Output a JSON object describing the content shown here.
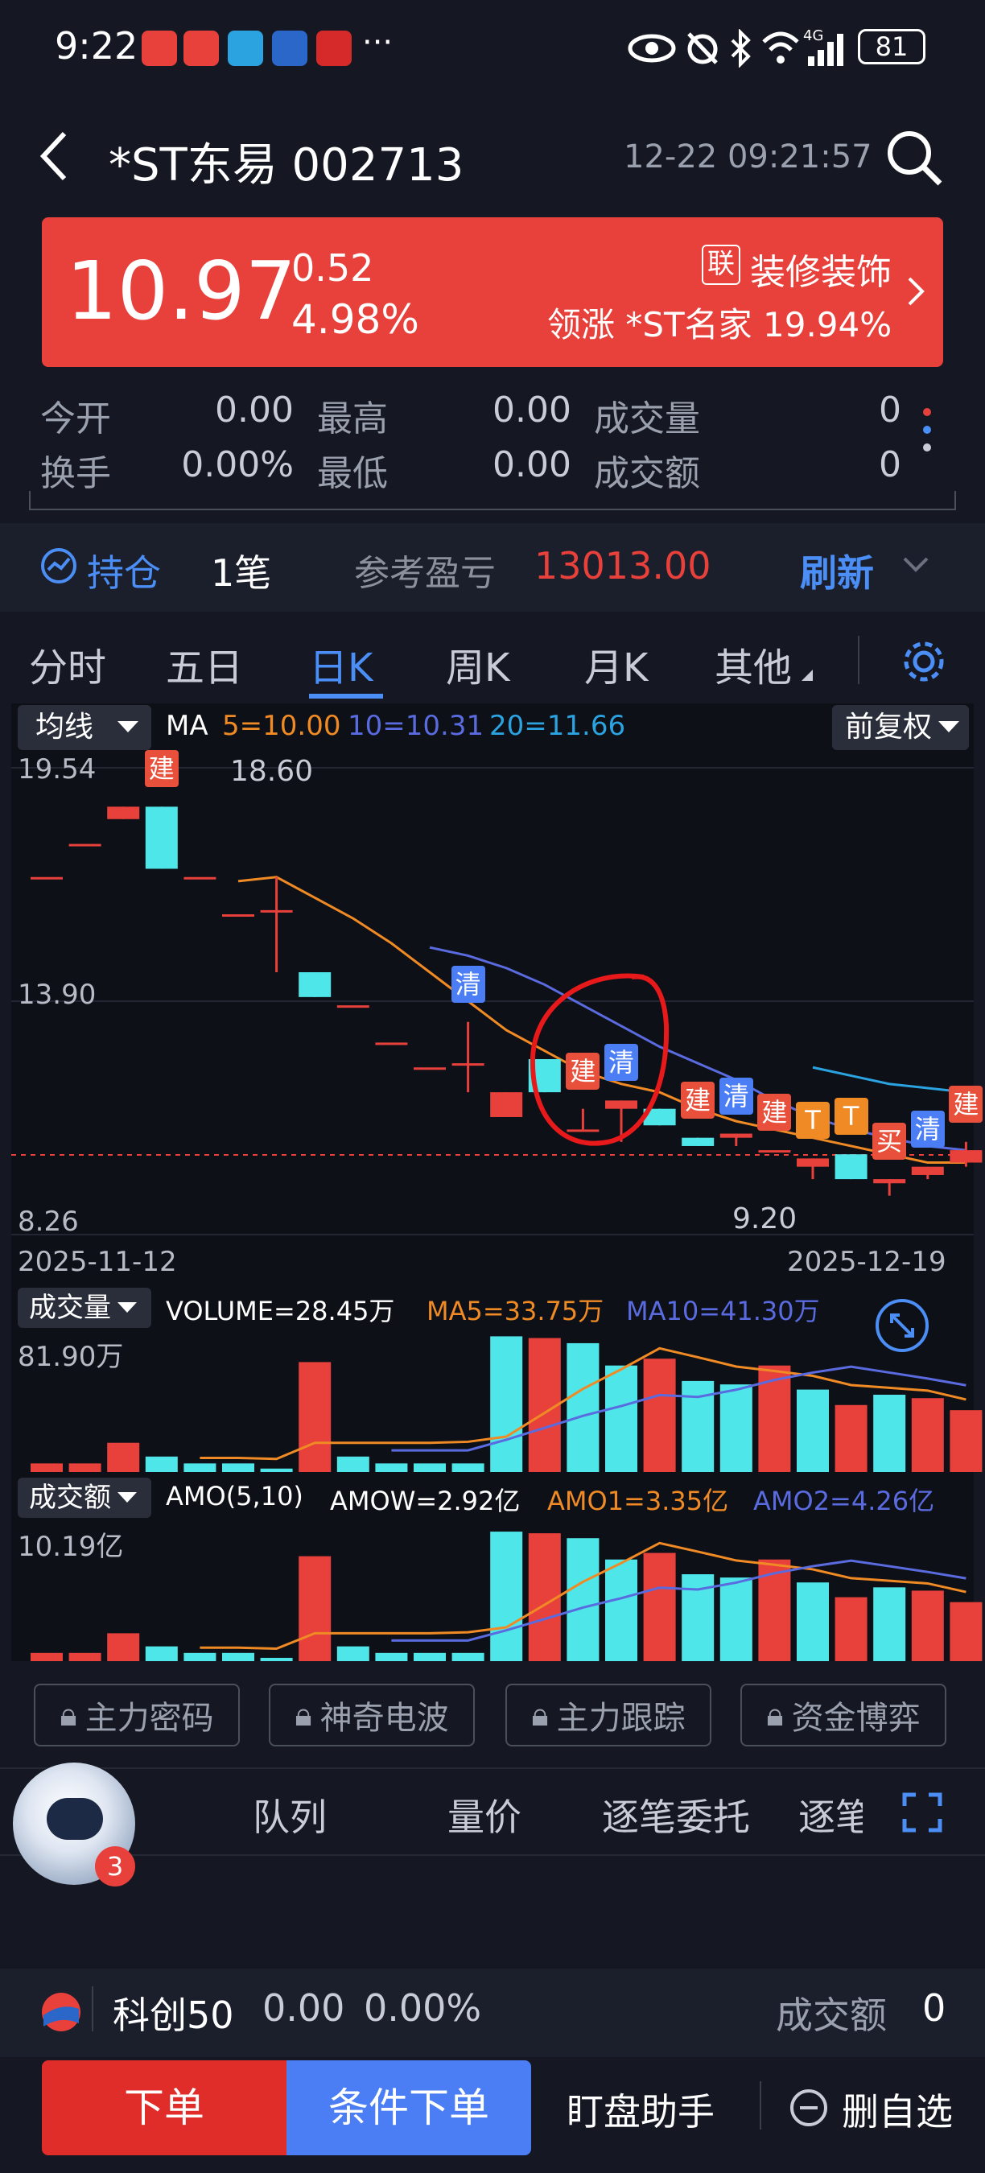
{
  "status": {
    "time": "9:22",
    "battery": "81",
    "network": "4G"
  },
  "header": {
    "title": "*ST东易 002713",
    "datetime": "12-22 09:21:57"
  },
  "banner": {
    "price": "10.97",
    "change": "0.52",
    "change_pct": "4.98%",
    "sector_tag": "联",
    "sector": "装修装饰",
    "leader": "领涨 *ST名家 19.94%",
    "color": "#e8403b"
  },
  "stats": {
    "open_label": "今开",
    "open": "0.00",
    "high_label": "最高",
    "high": "0.00",
    "vol_label": "成交量",
    "vol": "0",
    "turnover_label": "换手",
    "turnover": "0.00%",
    "low_label": "最低",
    "low": "0.00",
    "amount_label": "成交额",
    "amount": "0"
  },
  "position": {
    "label": "持仓",
    "count": "1笔",
    "pnl_label": "参考盈亏",
    "pnl": "13013.00",
    "refresh": "刷新"
  },
  "tabs": [
    "分时",
    "五日",
    "日K",
    "周K",
    "月K",
    "其他"
  ],
  "kline": {
    "ma_selector": "均线",
    "ma_label": "MA",
    "ma5": "5=10.00",
    "ma10": "10=10.31",
    "ma20": "20=11.66",
    "adjust": "前复权",
    "y_top": "19.54",
    "y_mid": "13.90",
    "y_bottom": "8.26",
    "max_mark": "18.60",
    "min_mark": "9.20",
    "date_start": "2025-11-12",
    "date_end": "2025-12-19",
    "signal_build": "建",
    "signal_clear": "清",
    "signal_t": "T",
    "signal_buy": "买"
  },
  "volume": {
    "selector": "成交量",
    "label": "VOLUME=28.45万",
    "ma5": "MA5=33.75万",
    "ma10": "MA10=41.30万",
    "max": "81.90万"
  },
  "amount": {
    "selector": "成交额",
    "label": "AMO(5,10)",
    "amow": "AMOW=2.92亿",
    "amo1": "AMO1=3.35亿",
    "amo2": "AMO2=4.26亿",
    "max": "10.19亿"
  },
  "tools": [
    "主力密码",
    "神奇电波",
    "主力跟踪",
    "资金博弈"
  ],
  "subtabs": [
    "队列",
    "量价",
    "逐笔委托",
    "逐笔"
  ],
  "avatar_badge": "3",
  "index_bar": {
    "name": "科创50",
    "value": "0.00",
    "pct": "0.00%",
    "amount_label": "成交额",
    "amount": "0"
  },
  "bottom": {
    "order": "下单",
    "cond_order": "条件下单",
    "assistant": "盯盘助手",
    "remove": "删自选"
  },
  "colors": {
    "up": "#e8403b",
    "down": "#4ee6e8",
    "accent": "#4b8ef5",
    "ma5": "#f08a24",
    "ma10": "#5a6be0",
    "ma20": "#2aa3e0"
  },
  "chart_data": {
    "type": "candlestick",
    "x_range": [
      "2025-11-12",
      "2025-12-19"
    ],
    "y_range": [
      8.26,
      19.54
    ],
    "candles": [
      {
        "o": 16.9,
        "c": 16.9,
        "h": 16.9,
        "l": 16.9
      },
      {
        "o": 17.7,
        "c": 17.7,
        "h": 17.7,
        "l": 17.7
      },
      {
        "o": 18.3,
        "c": 18.6,
        "h": 18.6,
        "l": 18.3
      },
      {
        "o": 18.6,
        "c": 17.1,
        "h": 18.6,
        "l": 17.1
      },
      {
        "o": 16.9,
        "c": 16.9,
        "h": 16.9,
        "l": 16.9
      },
      {
        "o": 16.0,
        "c": 16.0,
        "h": 16.0,
        "l": 16.0
      },
      {
        "o": 16.1,
        "c": 16.1,
        "h": 16.9,
        "l": 14.6
      },
      {
        "o": 14.6,
        "c": 14.0,
        "h": 14.6,
        "l": 14.0
      },
      {
        "o": 13.8,
        "c": 13.8,
        "h": 13.8,
        "l": 13.8
      },
      {
        "o": 12.9,
        "c": 12.9,
        "h": 12.9,
        "l": 12.9
      },
      {
        "o": 12.3,
        "c": 12.3,
        "h": 12.3,
        "l": 12.3
      },
      {
        "o": 12.4,
        "c": 12.4,
        "h": 13.4,
        "l": 11.7
      },
      {
        "o": 11.1,
        "c": 11.7,
        "h": 11.7,
        "l": 11.1
      },
      {
        "o": 12.5,
        "c": 11.7,
        "h": 12.5,
        "l": 11.7
      },
      {
        "o": 10.8,
        "c": 10.8,
        "h": 11.3,
        "l": 10.8
      },
      {
        "o": 11.3,
        "c": 11.5,
        "h": 11.5,
        "l": 10.5
      },
      {
        "o": 11.3,
        "c": 10.9,
        "h": 11.3,
        "l": 10.9
      },
      {
        "o": 10.6,
        "c": 10.4,
        "h": 10.6,
        "l": 10.4
      },
      {
        "o": 10.6,
        "c": 10.7,
        "h": 10.7,
        "l": 10.4
      },
      {
        "o": 10.3,
        "c": 10.3,
        "h": 10.3,
        "l": 10.3
      },
      {
        "o": 9.9,
        "c": 10.1,
        "h": 10.1,
        "l": 9.6
      },
      {
        "o": 10.2,
        "c": 9.6,
        "h": 10.2,
        "l": 9.6
      },
      {
        "o": 9.5,
        "c": 9.6,
        "h": 9.6,
        "l": 9.2
      },
      {
        "o": 9.7,
        "c": 9.9,
        "h": 9.9,
        "l": 9.6
      },
      {
        "o": 10.0,
        "c": 10.3,
        "h": 10.5,
        "l": 9.9
      }
    ],
    "volume": [
      5,
      5,
      17,
      9,
      5,
      5,
      2,
      64,
      9,
      5,
      5,
      5,
      79,
      78,
      75,
      62,
      66,
      53,
      51,
      62,
      48,
      39,
      45,
      43,
      36
    ],
    "volume_up": [
      true,
      true,
      true,
      false,
      false,
      false,
      false,
      true,
      false,
      false,
      false,
      false,
      false,
      true,
      false,
      false,
      true,
      false,
      false,
      true,
      false,
      true,
      false,
      true,
      true
    ],
    "ma5": [
      null,
      null,
      null,
      null,
      null,
      16.8,
      16.9,
      16.4,
      15.9,
      15.3,
      14.6,
      13.9,
      13.2,
      12.7,
      12.2,
      11.9,
      11.7,
      11.3,
      11.0,
      10.8,
      10.6,
      10.4,
      10.2,
      10.0,
      10.0
    ],
    "ma10": [
      null,
      null,
      null,
      null,
      null,
      null,
      null,
      null,
      null,
      null,
      15.2,
      15.0,
      14.7,
      14.3,
      13.8,
      13.3,
      12.8,
      12.4,
      12.0,
      11.5,
      11.1,
      10.8,
      10.6,
      10.4,
      10.3
    ],
    "ma20": [
      null,
      null,
      null,
      null,
      null,
      null,
      null,
      null,
      null,
      null,
      null,
      null,
      null,
      null,
      null,
      null,
      null,
      null,
      null,
      null,
      12.3,
      12.1,
      11.9,
      11.8,
      11.7
    ]
  }
}
